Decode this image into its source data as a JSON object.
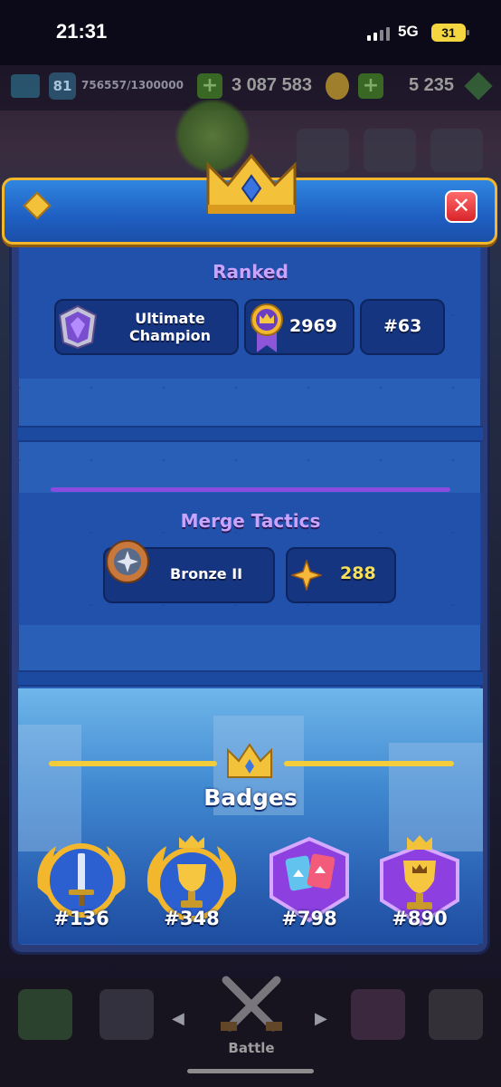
{
  "status_bar": {
    "time": "21:31",
    "network": "5G",
    "battery": "31"
  },
  "hud": {
    "level": "81",
    "xp": "756557/1300000",
    "gold": "3 087 583",
    "gems": "5 235"
  },
  "ranked": {
    "title": "Ranked",
    "league_line1": "Ultimate",
    "league_line2": "Champion",
    "trophies": "2969",
    "rank": "#63"
  },
  "merge_tactics": {
    "title": "Merge Tactics",
    "league": "Bronze II",
    "points": "288"
  },
  "badges": {
    "title": "Badges",
    "items": [
      {
        "icon": "sword-badge-icon",
        "rank": "#136"
      },
      {
        "icon": "trophy-badge-icon",
        "rank": "#348"
      },
      {
        "icon": "cards-badge-icon",
        "rank": "#798"
      },
      {
        "icon": "crown-trophy-badge-icon",
        "rank": "#890"
      }
    ]
  },
  "nav": {
    "battle_label": "Battle"
  },
  "colors": {
    "header_gold": "#f2b72c",
    "section_title_purple": "#c7a4ff",
    "close_red": "#d8242a"
  }
}
